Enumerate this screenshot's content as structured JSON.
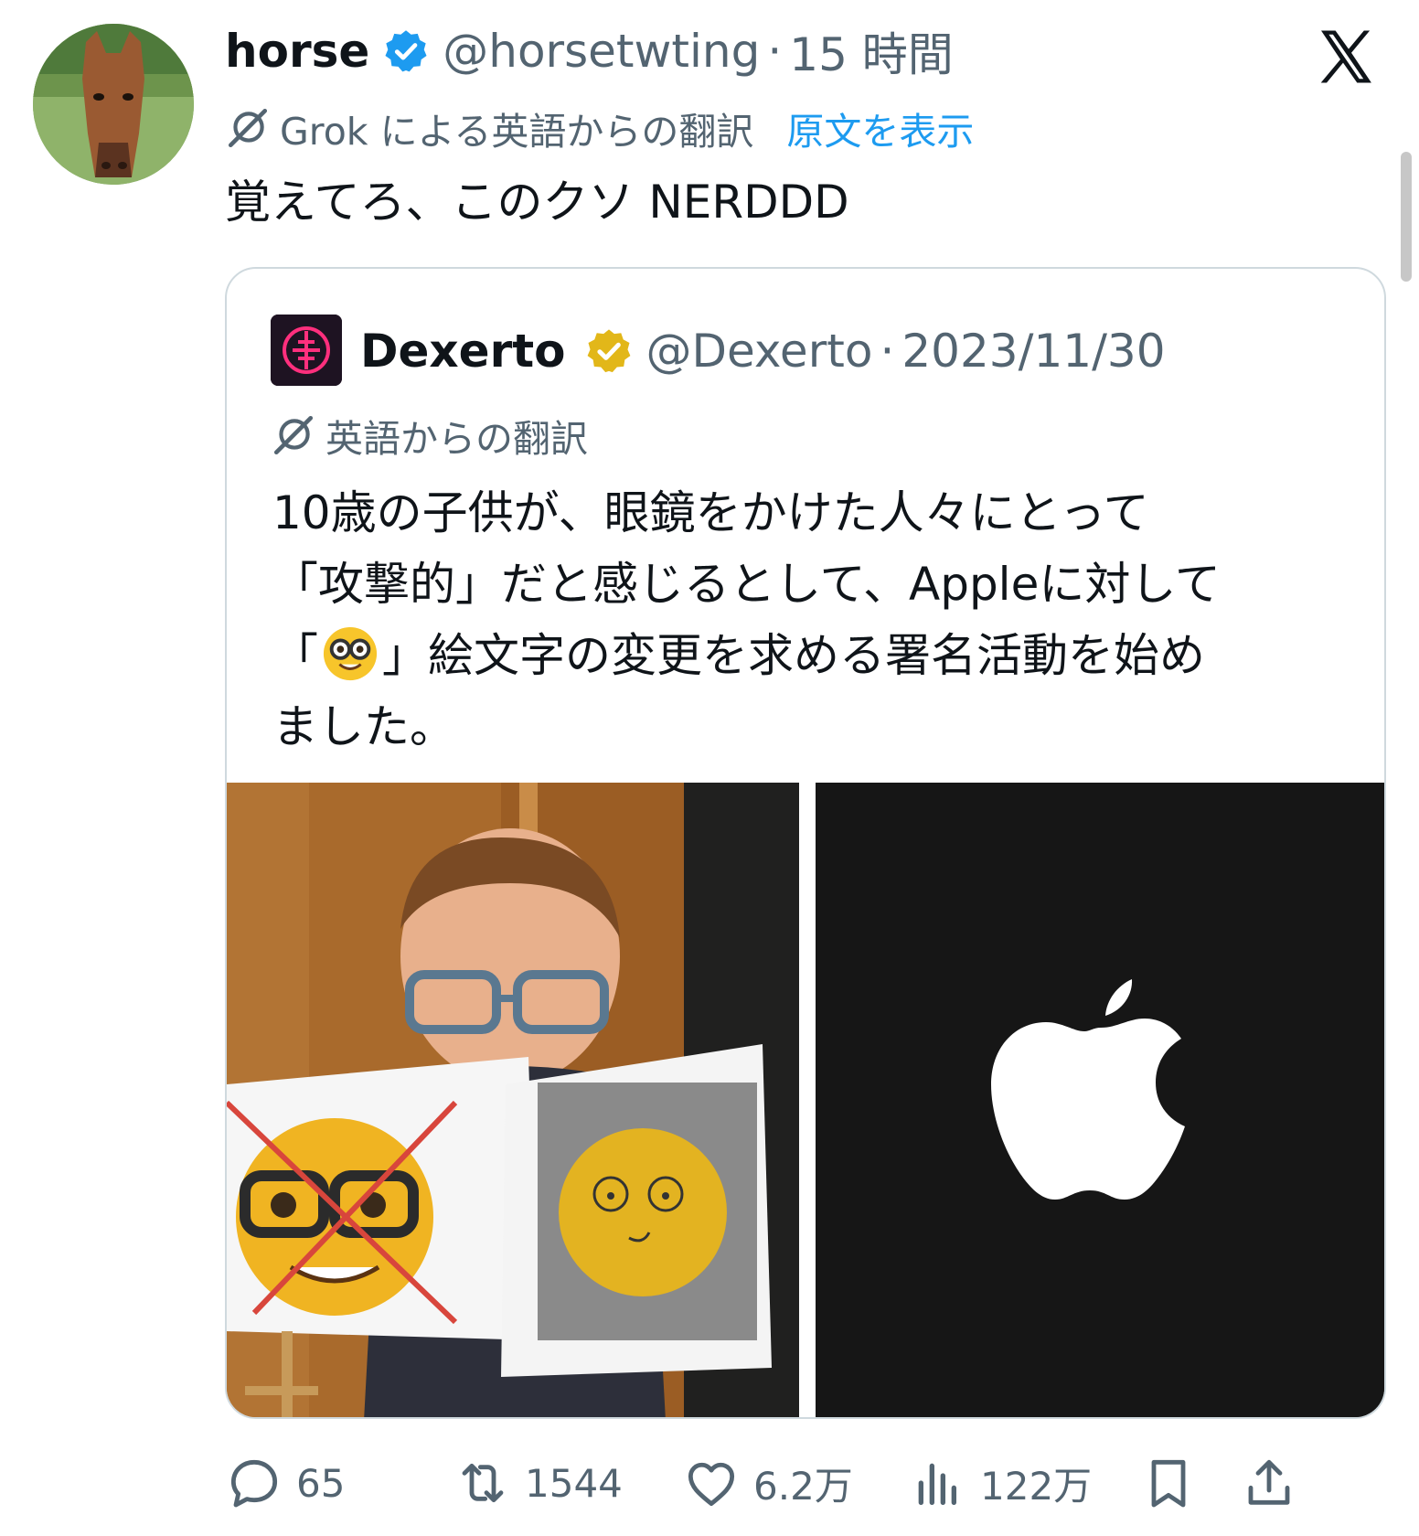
{
  "tweet": {
    "author_name": "horse",
    "handle": "@horsetwting",
    "separator": "·",
    "time": "15 時間",
    "translation_note": "Grok による英語からの翻訳",
    "show_original": "原文を表示",
    "text": "覚えてろ、このクソ NERDDD"
  },
  "quote": {
    "author_name": "Dexerto",
    "handle": "@Dexerto",
    "separator": "·",
    "date": "2023/11/30",
    "translation_note": "英語からの翻訳",
    "text_lines": [
      "10歳の子供が、眼鏡をかけた人々にとって",
      "「攻撃的」だと感じるとして、Appleに対して",
      "「",
      "」絵文字の変更を求める署名活動を始め",
      "ました。"
    ]
  },
  "actions": {
    "replies": "65",
    "reposts": "1544",
    "likes": "6.2万",
    "views": "122万"
  },
  "colors": {
    "verified_blue": "#1d9bf0",
    "verified_gold": "#e2b719",
    "link_blue": "#1d9bf0",
    "secondary_text": "#536471"
  },
  "icons": [
    "x-logo-icon",
    "verified-badge-icon",
    "grok-icon",
    "gold-verified-badge-icon",
    "nerd-face-emoji-icon",
    "reply-icon",
    "repost-icon",
    "like-icon",
    "views-icon",
    "bookmark-icon",
    "share-icon",
    "apple-logo-icon"
  ]
}
